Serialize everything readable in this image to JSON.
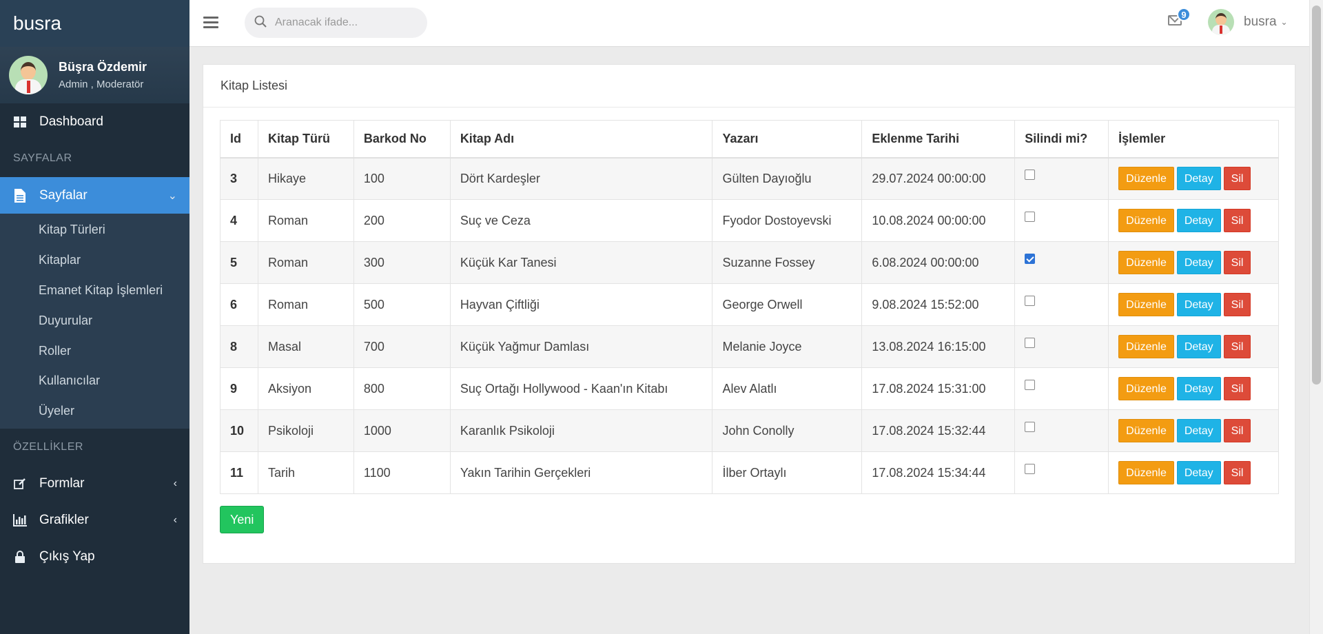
{
  "app": {
    "brand": "busra"
  },
  "user_panel": {
    "name": "Büşra Özdemir",
    "role": "Admin , Moderatör"
  },
  "sidebar": {
    "dashboard": "Dashboard",
    "section_pages": "SAYFALAR",
    "pages_menu": "Sayfalar",
    "sub_items": [
      "Kitap Türleri",
      "Kitaplar",
      "Emanet Kitap İşlemleri",
      "Duyurular",
      "Roller",
      "Kullanıcılar",
      "Üyeler"
    ],
    "section_features": "ÖZELLİKLER",
    "forms": "Formlar",
    "charts": "Grafikler",
    "logout": "Çıkış Yap"
  },
  "topbar": {
    "search_placeholder": "Aranacak ifade...",
    "mail_count": "9",
    "username": "busra"
  },
  "card": {
    "title": "Kitap Listesi",
    "new_button": "Yeni"
  },
  "table": {
    "headers": [
      "Id",
      "Kitap Türü",
      "Barkod No",
      "Kitap Adı",
      "Yazarı",
      "Eklenme Tarihi",
      "Silindi mi?",
      "İşlemler"
    ],
    "rows": [
      {
        "id": "3",
        "type": "Hikaye",
        "barcode": "100",
        "title": "Dört Kardeşler",
        "author": "Gülten Dayıoğlu",
        "date": "29.07.2024 00:00:00",
        "deleted": false
      },
      {
        "id": "4",
        "type": "Roman",
        "barcode": "200",
        "title": "Suç ve Ceza",
        "author": "Fyodor Dostoyevski",
        "date": "10.08.2024 00:00:00",
        "deleted": false
      },
      {
        "id": "5",
        "type": "Roman",
        "barcode": "300",
        "title": "Küçük Kar Tanesi",
        "author": "Suzanne Fossey",
        "date": "6.08.2024 00:00:00",
        "deleted": true
      },
      {
        "id": "6",
        "type": "Roman",
        "barcode": "500",
        "title": "Hayvan Çiftliği",
        "author": "George Orwell",
        "date": "9.08.2024 15:52:00",
        "deleted": false
      },
      {
        "id": "8",
        "type": "Masal",
        "barcode": "700",
        "title": "Küçük Yağmur Damlası",
        "author": "Melanie Joyce",
        "date": "13.08.2024 16:15:00",
        "deleted": false
      },
      {
        "id": "9",
        "type": "Aksiyon",
        "barcode": "800",
        "title": "Suç Ortağı Hollywood - Kaan'ın Kitabı",
        "author": "Alev Alatlı",
        "date": "17.08.2024 15:31:00",
        "deleted": false
      },
      {
        "id": "10",
        "type": "Psikoloji",
        "barcode": "1000",
        "title": "Karanlık Psikoloji",
        "author": "John Conolly",
        "date": "17.08.2024 15:32:44",
        "deleted": false
      },
      {
        "id": "11",
        "type": "Tarih",
        "barcode": "1100",
        "title": "Yakın Tarihin Gerçekleri",
        "author": "İlber Ortaylı",
        "date": "17.08.2024 15:34:44",
        "deleted": false
      }
    ],
    "actions": {
      "edit": "Düzenle",
      "detail": "Detay",
      "delete": "Sil"
    }
  }
}
